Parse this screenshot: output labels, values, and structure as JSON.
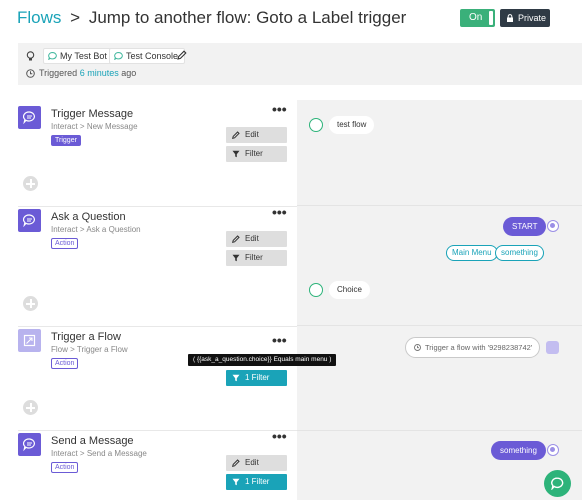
{
  "header": {
    "flows_link": "Flows",
    "separator": ">",
    "title": "Jump to another flow: Goto a Label trigger",
    "toggle_label": "On",
    "private_label": "Private"
  },
  "info": {
    "chips": [
      "My Test Bot",
      "Test Console"
    ],
    "triggered_prefix": "Triggered",
    "triggered_ago": "6 minutes",
    "triggered_suffix": "ago"
  },
  "steps": [
    {
      "title": "Trigger Message",
      "path_app": "Interact",
      "path_arrow": ">",
      "path_item": "New Message",
      "badge": "Trigger"
    },
    {
      "title": "Ask a Question",
      "path_app": "Interact",
      "path_arrow": ">",
      "path_item": "Ask a Question",
      "badge": "Action"
    },
    {
      "title": "Trigger a Flow",
      "path_app": "Flow",
      "path_arrow": ">",
      "path_item": "Trigger a Flow",
      "badge": "Action"
    },
    {
      "title": "Send a Message",
      "path_app": "Interact",
      "path_arrow": ">",
      "path_item": "Send a Message",
      "badge": "Action"
    }
  ],
  "buttons": {
    "edit": "Edit",
    "filter": "Filter",
    "one_filter": "1 Filter"
  },
  "tooltip": "( {{ask_a_question.choice}} Equals main menu )",
  "preview": {
    "test_flow": "test flow",
    "start": "START",
    "quick_replies": [
      "Main Menu",
      "something"
    ],
    "choice": "Choice",
    "trigger_flow_text": "Trigger a flow with '9298238742'",
    "something": "something"
  },
  "colors": {
    "accent_teal": "#1aa3b8",
    "purple": "#6b5bd6",
    "green": "#3ab07a",
    "dark": "#2f3a45"
  }
}
